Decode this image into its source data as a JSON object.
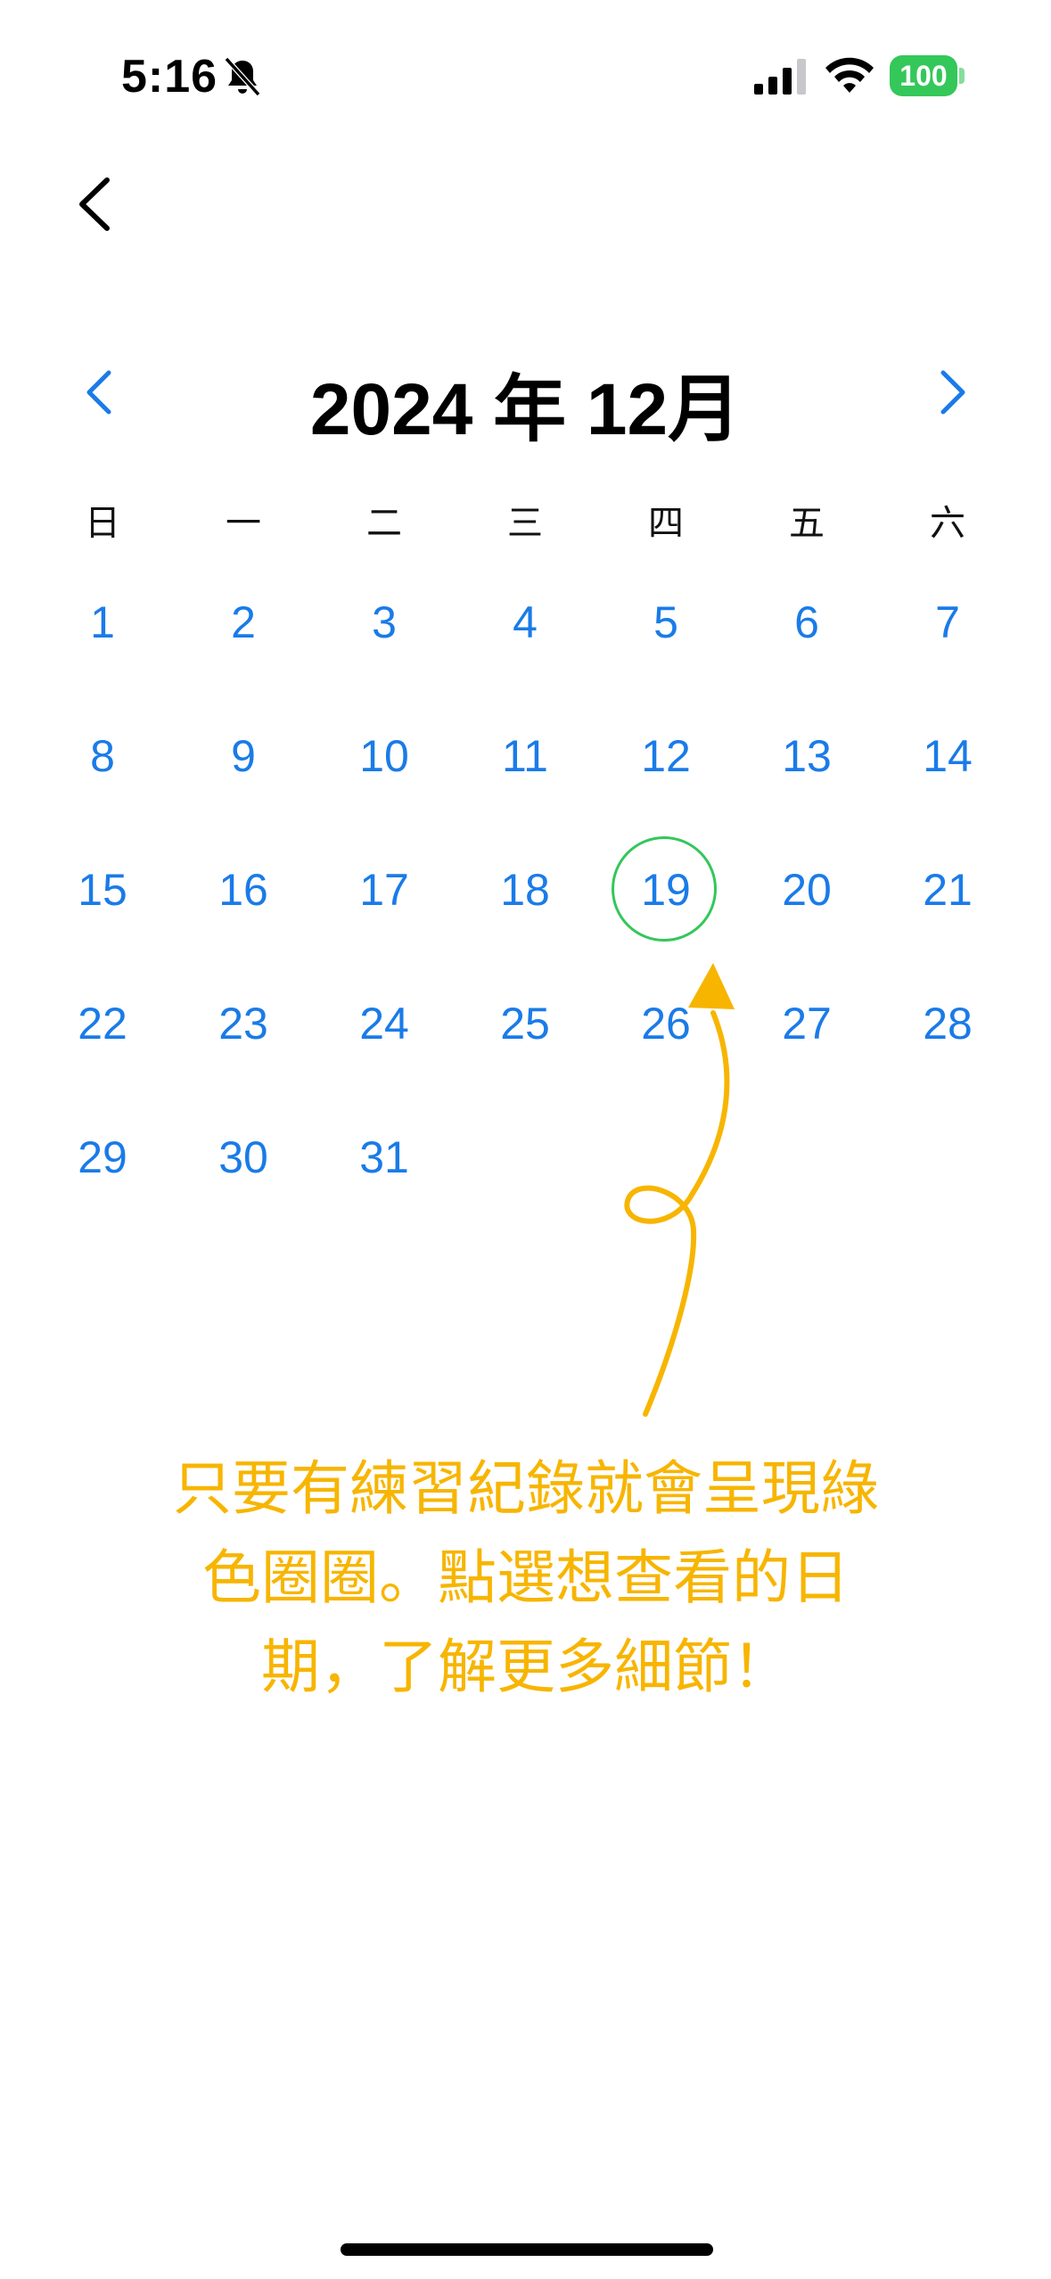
{
  "status_bar": {
    "time": "5:16",
    "battery": "100"
  },
  "calendar": {
    "title": "2024 年 12月",
    "weekdays": [
      "日",
      "一",
      "二",
      "三",
      "四",
      "五",
      "六"
    ],
    "days": [
      "1",
      "2",
      "3",
      "4",
      "5",
      "6",
      "7",
      "8",
      "9",
      "10",
      "11",
      "12",
      "13",
      "14",
      "15",
      "16",
      "17",
      "18",
      "19",
      "20",
      "21",
      "22",
      "23",
      "24",
      "25",
      "26",
      "27",
      "28",
      "29",
      "30",
      "31"
    ],
    "start_weekday_index": 0,
    "recorded_day": "19"
  },
  "annotation": {
    "lines": [
      "只要有練習紀錄就會呈現綠",
      "色圈圈。點選想查看的日",
      "期，了解更多細節！"
    ]
  },
  "colors": {
    "day_text": "#1a7be8",
    "recorded_ring": "#34c759",
    "annotation": "#f7b500"
  },
  "icons": [
    "silent-bell-icon",
    "cellular-signal-icon",
    "wifi-icon",
    "battery-icon",
    "back-chevron-icon",
    "previous-month-icon",
    "next-month-icon",
    "curly-arrow-icon"
  ]
}
